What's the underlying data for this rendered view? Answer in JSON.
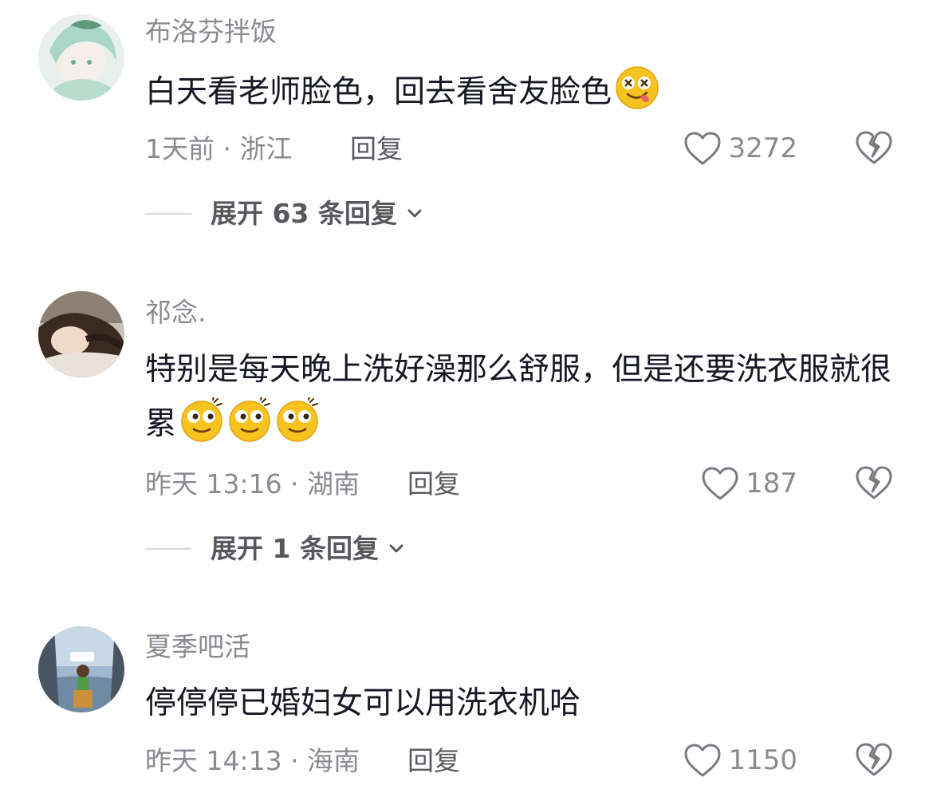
{
  "comments": [
    {
      "username": "布洛芬拌饭",
      "text": "白天看老师脸色，回去看舍友脸色",
      "emojis": [
        "dizzy-tongue-emoji"
      ],
      "time_location": "1天前 · 浙江",
      "reply_label": "回复",
      "likes": "3272",
      "expand_label": "展开 63 条回复"
    },
    {
      "username": "祁念.",
      "text": "特别是每天晚上洗好澡那么舒服，但是还要洗衣服就很累",
      "emojis": [
        "tired-emoji",
        "tired-emoji",
        "tired-emoji"
      ],
      "time_location": "昨天 13:16 · 湖南",
      "reply_label": "回复",
      "likes": "187",
      "expand_label": "展开 1 条回复"
    },
    {
      "username": "夏季吧活",
      "text": "停停停已婚妇女可以用洗衣机哈",
      "emojis": [],
      "time_location": "昨天 14:13 · 海南",
      "reply_label": "回复",
      "likes": "1150"
    }
  ],
  "icons": {
    "like": "heart-outline-icon",
    "dislike": "broken-heart-icon",
    "expand": "chevron-down-icon"
  },
  "colors": {
    "primary_text": "#161823",
    "secondary_text": "#8a8b91",
    "emoji_yellow": "#f7c31f"
  }
}
